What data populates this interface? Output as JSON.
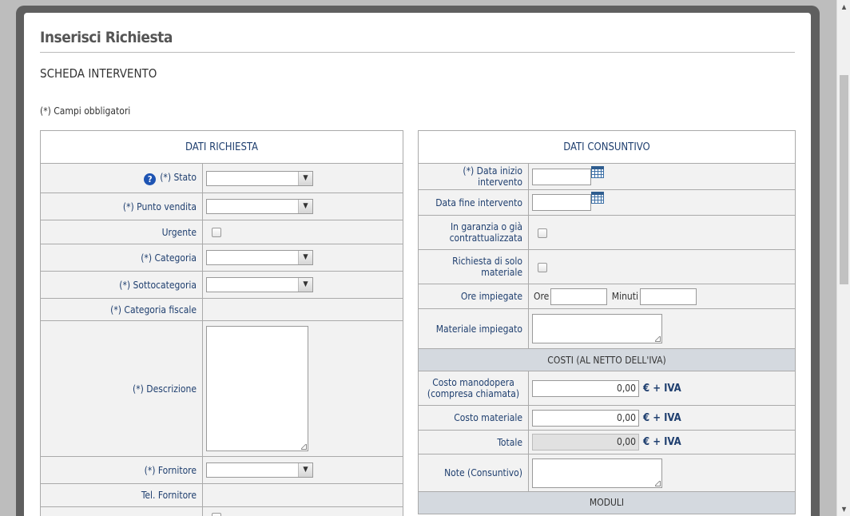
{
  "modal": {
    "title": "Inserisci Richiesta",
    "section_title": "SCHEDA INTERVENTO",
    "required_note": "(*) Campi obbligatori"
  },
  "left_panel": {
    "header": "DATI RICHIESTA",
    "stato_label": "(*) Stato",
    "punto_vendita_label": "(*) Punto vendita",
    "urgente_label": "Urgente",
    "categoria_label": "(*) Categoria",
    "sottocategoria_label": "(*) Sottocategoria",
    "categoria_fiscale_label": "(*) Categoria fiscale",
    "descrizione_label": "(*) Descrizione",
    "fornitore_label": "(*) Fornitore",
    "tel_fornitore_label": "Tel. Fornitore"
  },
  "right_panel": {
    "header": "DATI CONSUNTIVO",
    "data_inizio_label": "(*) Data inizio intervento",
    "data_fine_label": "Data fine intervento",
    "garanzia_label": "In garanzia o già contrattualizzata",
    "solo_materiale_label": "Richiesta di solo materiale",
    "ore_impiegate_label": "Ore impiegate",
    "ore_label": "Ore",
    "minuti_label": "Minuti",
    "materiale_impiegato_label": "Materiale impiegato",
    "costi_header": "COSTI (AL NETTO DELL'IVA)",
    "costo_manodopera_label": "Costo manodopera (compresa chiamata)",
    "costo_manodopera_value": "0,00",
    "costo_materiale_label": "Costo materiale",
    "costo_materiale_value": "0,00",
    "totale_label": "Totale",
    "totale_value": "0,00",
    "unit_label": "€ + IVA",
    "note_label": "Note (Consuntivo)",
    "moduli_header": "MODULI"
  },
  "icons": {
    "help": "?",
    "dropdown_arrow": "▼",
    "scroll_up": "▲",
    "scroll_down": "▼"
  }
}
